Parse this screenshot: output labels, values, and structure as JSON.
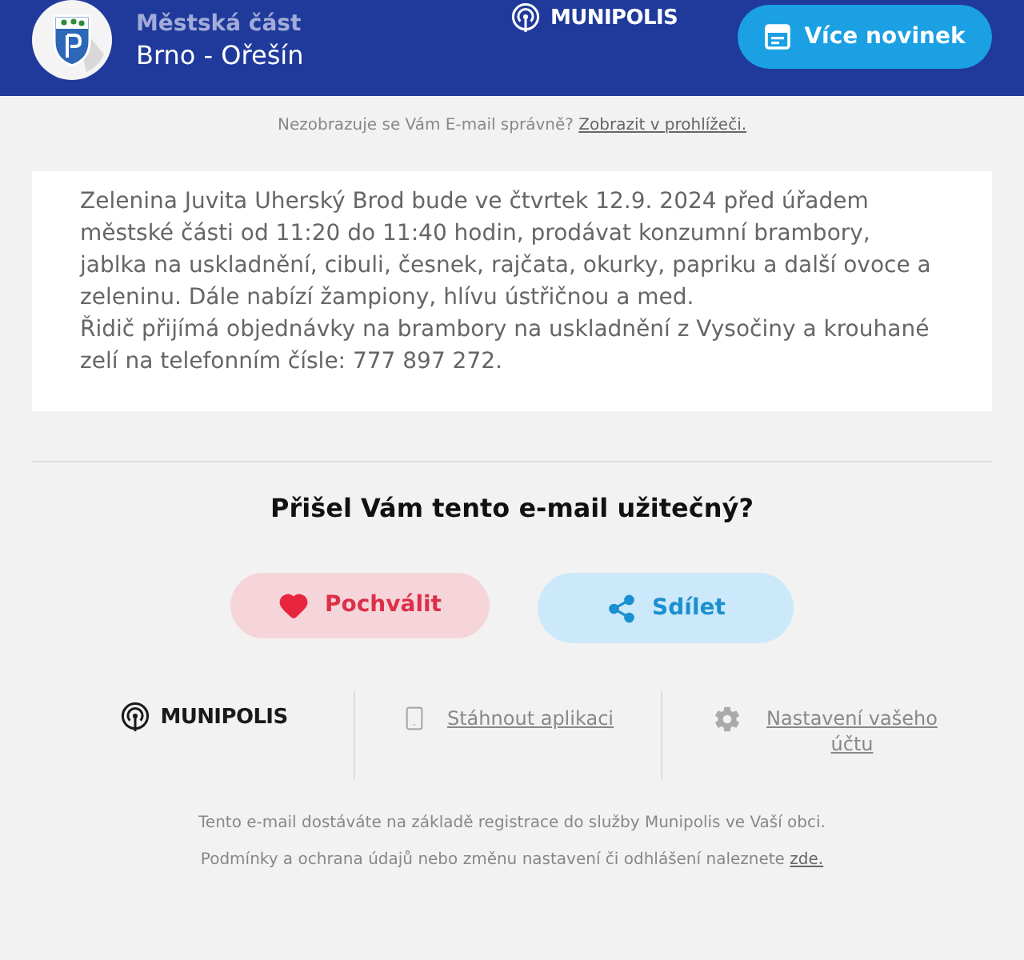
{
  "header": {
    "municipality_label": "Městská část",
    "municipality_name": "Brno - Ořešín",
    "brand": "MUNIPOLIS",
    "news_button": "Více novinek"
  },
  "browser_notice": {
    "text": "Nezobrazuje se Vám E-mail správně?",
    "link": "Zobrazit v prohlížeči."
  },
  "message": {
    "paragraphs": [
      "Zelenina Juvita Uherský Brod bude ve čtvrtek 12.9. 2024 před úřadem městské části od 11:20 do 11:40 hodin, prodávat konzumní brambory, jablka na uskladnění, cibuli, česnek, rajčata, okurky, papriku a další ovoce a zeleninu. Dále nabízí žampiony, hlívu ústřičnou a med.",
      "Řidič přijímá objednávky na brambory na uskladnění z Vysočiny a krouhané zelí na telefonním čísle: 777 897 272."
    ]
  },
  "feedback": {
    "question": "Přišel Vám tento e-mail užitečný?",
    "buttons": [
      {
        "kind": "praise",
        "label": "Pochválit"
      },
      {
        "kind": "share",
        "label": "Sdílet"
      }
    ]
  },
  "footer": {
    "brand": "MUNIPOLIS",
    "links": [
      {
        "kind": "app",
        "label": "Stáhnout aplikaci"
      },
      {
        "kind": "settings",
        "label": "Nastavení vašeho účtu"
      }
    ],
    "note": "Tento e-mail dostáváte na základě registrace do služby Munipolis ve Vaší obci.",
    "terms": {
      "text": "Podmínky a ochrana údajů nebo změnu nastavení či odhlášení naleznete",
      "link": "zde."
    }
  }
}
